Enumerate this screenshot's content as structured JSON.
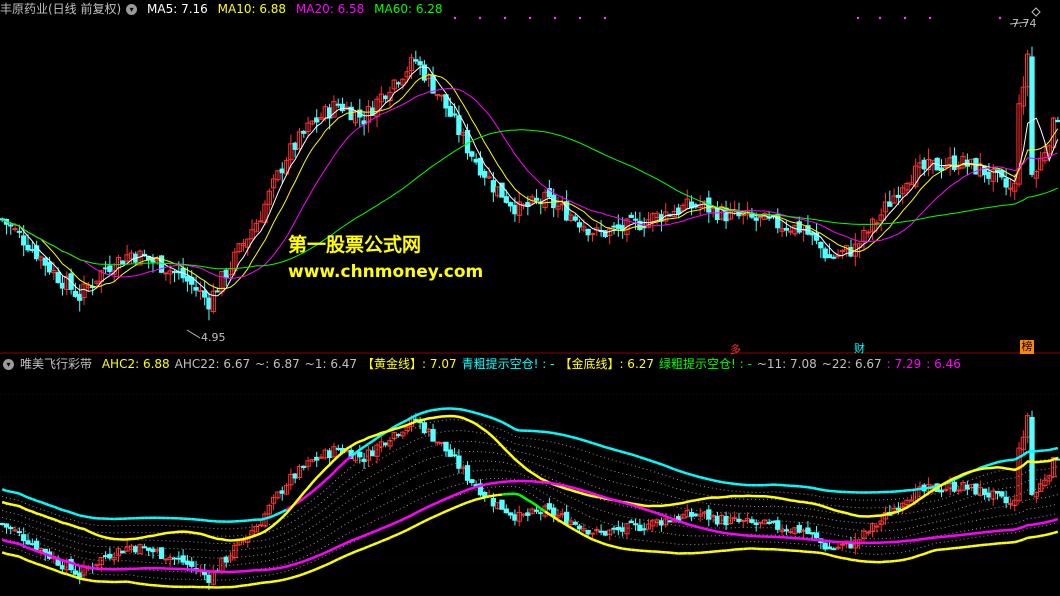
{
  "main_header": {
    "title": "丰原药业(日线 前复权)",
    "ma": [
      {
        "label": "MA5: 7.16",
        "color": "#ffffff"
      },
      {
        "label": "MA10: 6.88",
        "color": "#ffff00"
      },
      {
        "label": "MA20: 6.58",
        "color": "#ff00ff"
      },
      {
        "label": "MA60: 6.28",
        "color": "#00ff00"
      }
    ]
  },
  "sub_header": {
    "title": "唯美飞行彩带",
    "items": [
      {
        "label": "AHC2: 6.88",
        "color": "#ffff00"
      },
      {
        "label": "AHC22: 6.67",
        "color": "#c0c0c0"
      },
      {
        "label": "~: 6.87",
        "color": "#c0c0c0"
      },
      {
        "label": "~1: 6.47",
        "color": "#c0c0c0"
      },
      {
        "label": "【黄金线】: 7.07",
        "color": "#ffff00"
      },
      {
        "label": "青粗提示空仓! : -",
        "color": "#00ffff"
      },
      {
        "label": "【金底线】: 6.27",
        "color": "#ffff00"
      },
      {
        "label": "绿粗提示空仓! : -",
        "color": "#00ff00"
      },
      {
        "label": "~11: 7.08",
        "color": "#c0c0c0"
      },
      {
        "label": "~22: 6.67",
        "color": "#c0c0c0"
      },
      {
        "label": ": 7.29",
        "color": "#ff00ff"
      },
      {
        "label": ": 6.46",
        "color": "#ff00ff"
      }
    ]
  },
  "watermark": {
    "line1": "第一股票公式网",
    "line2": "www.chnmoney.com"
  },
  "annotations": {
    "high": "7.74",
    "low": "4.95",
    "marker1": "多",
    "marker2": "财",
    "marker3": "榜"
  },
  "colors": {
    "up": "#ff3232",
    "down": "#54ffff",
    "ma5": "#ffffff",
    "ma10": "#ffff00",
    "ma20": "#ff00ff",
    "ma60": "#00ff00"
  },
  "chart_data": [
    {
      "type": "line",
      "title": "丰原药业(日线 前复权)",
      "ylim": [
        4.7,
        7.9
      ],
      "anchors_x": [
        0,
        6,
        12,
        18,
        24,
        30,
        36,
        42,
        48,
        54,
        60,
        66,
        72,
        78,
        84,
        90,
        96,
        102,
        108,
        114,
        120,
        126,
        132,
        138,
        144,
        150,
        156,
        162,
        168,
        174,
        180,
        186,
        192,
        198,
        204,
        210,
        216,
        222,
        228,
        234,
        240,
        246
      ],
      "anchors_close": [
        5.85,
        5.6,
        5.3,
        5.05,
        5.35,
        5.5,
        5.4,
        5.25,
        5.0,
        5.45,
        5.9,
        6.5,
        6.85,
        7.05,
        6.9,
        7.25,
        7.5,
        7.1,
        6.6,
        6.2,
        5.95,
        6.05,
        5.9,
        5.7,
        5.75,
        5.85,
        5.95,
        6.0,
        5.9,
        5.85,
        5.8,
        5.75,
        5.45,
        5.55,
        5.9,
        6.3,
        6.4,
        6.45,
        6.35,
        6.15,
        6.35,
        7.05
      ],
      "low_label": "4.95",
      "high_label": "7.74",
      "series": [
        {
          "name": "MA5",
          "last": "7.16"
        },
        {
          "name": "MA10",
          "last": "6.88"
        },
        {
          "name": "MA20",
          "last": "6.58"
        },
        {
          "name": "MA60",
          "last": "6.28"
        }
      ]
    },
    {
      "type": "line",
      "title": "唯美飞行彩带",
      "series": [
        {
          "name": "【黄金线】",
          "last": "7.07"
        },
        {
          "name": "【金底线】",
          "last": "6.27"
        },
        {
          "name": "~11",
          "last": "7.08"
        },
        {
          "name": "~22",
          "last": "6.67"
        }
      ]
    }
  ]
}
